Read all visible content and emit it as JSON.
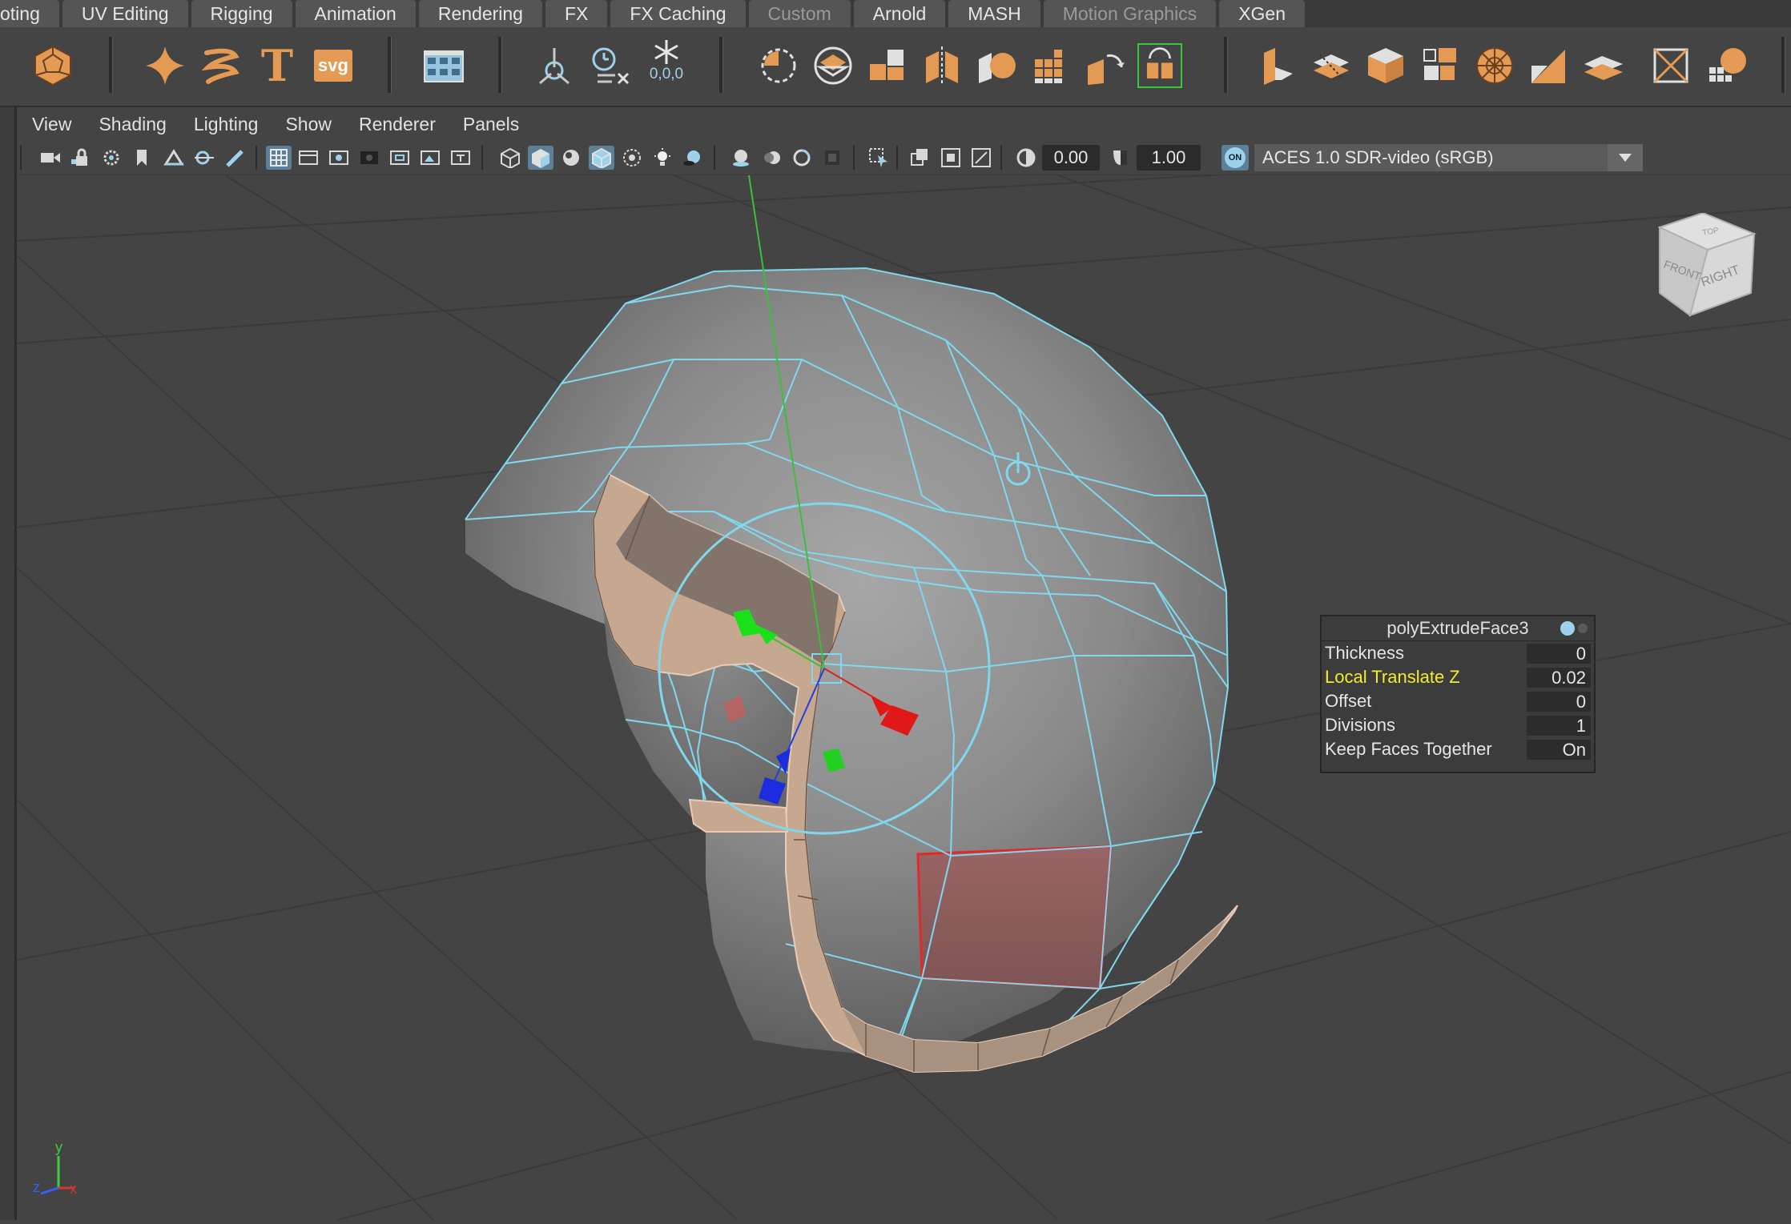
{
  "shelf_tabs": [
    {
      "label": "oting",
      "dim": false
    },
    {
      "label": "UV Editing",
      "dim": false
    },
    {
      "label": "Rigging",
      "dim": false
    },
    {
      "label": "Animation",
      "dim": false
    },
    {
      "label": "Rendering",
      "dim": false
    },
    {
      "label": "FX",
      "dim": false
    },
    {
      "label": "FX Caching",
      "dim": false
    },
    {
      "label": "Custom",
      "dim": true
    },
    {
      "label": "Arnold",
      "dim": false
    },
    {
      "label": "MASH",
      "dim": false
    },
    {
      "label": "Motion Graphics",
      "dim": true
    },
    {
      "label": "XGen",
      "dim": false
    }
  ],
  "shelf": {
    "text_tool_glyph": "T",
    "svg_tool_label": "svg",
    "snap_readout": "0,0,0",
    "accent_color": "#e59a54"
  },
  "panel_menu": [
    "View",
    "Shading",
    "Lighting",
    "Show",
    "Renderer",
    "Panels"
  ],
  "panel_toolbar": {
    "exposure": "0.00",
    "gamma": "1.00",
    "color_mgmt_badge": "ON",
    "color_space": "ACES 1.0 SDR-video (sRGB)"
  },
  "view_cube": {
    "top": "TOP",
    "front": "FRONT",
    "right": "RIGHT"
  },
  "axis_indicator": {
    "x": "x",
    "y": "y",
    "z": "z"
  },
  "hud": {
    "title": "polyExtrudeFace3",
    "rows": [
      {
        "label": "Thickness",
        "value": "0",
        "highlight": false
      },
      {
        "label": "Local Translate Z",
        "value": "0.02",
        "highlight": true
      },
      {
        "label": "Offset",
        "value": "0",
        "highlight": false
      },
      {
        "label": "Divisions",
        "value": "1",
        "highlight": false
      },
      {
        "label": "Keep Faces Together",
        "value": "On",
        "highlight": false
      }
    ]
  },
  "colors": {
    "wireframe": "#7fd8ee",
    "selected_face": "#a56464",
    "extrude_rim": "#c8a890",
    "highlight_label": "#f2ec2a"
  }
}
